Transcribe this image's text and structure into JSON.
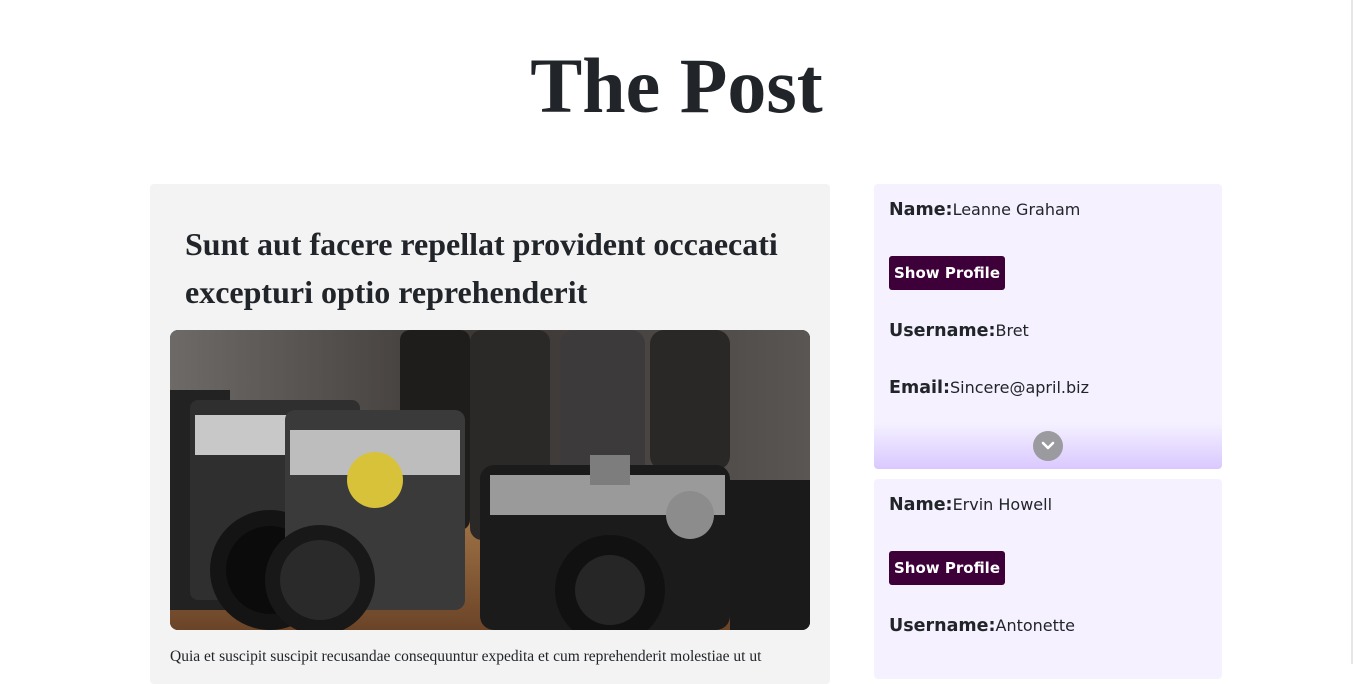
{
  "page": {
    "title": "The Post"
  },
  "post": {
    "title": "Sunt aut facere repellat provident occaecati excepturi optio reprehenderit",
    "image_alt": "vintage cameras",
    "body": "Quia et suscipit suscipit recusandae consequuntur expedita et cum reprehenderit molestiae ut ut"
  },
  "users": [
    {
      "name_label": "Name:",
      "name": "Leanne Graham",
      "button": "Show Profile",
      "username_label": "Username:",
      "username": "Bret",
      "email_label": "Email:",
      "email": "Sincere@april.biz",
      "expand_icon": "chevron-down-icon"
    },
    {
      "name_label": "Name:",
      "name": "Ervin Howell",
      "button": "Show Profile",
      "username_label": "Username:",
      "username": "Antonette"
    }
  ],
  "colors": {
    "button_bg": "#3d0038",
    "card_bg": "#f5f1ff",
    "post_bg": "#f3f3f3",
    "expand_gradient_end": "#d9c8ff"
  }
}
